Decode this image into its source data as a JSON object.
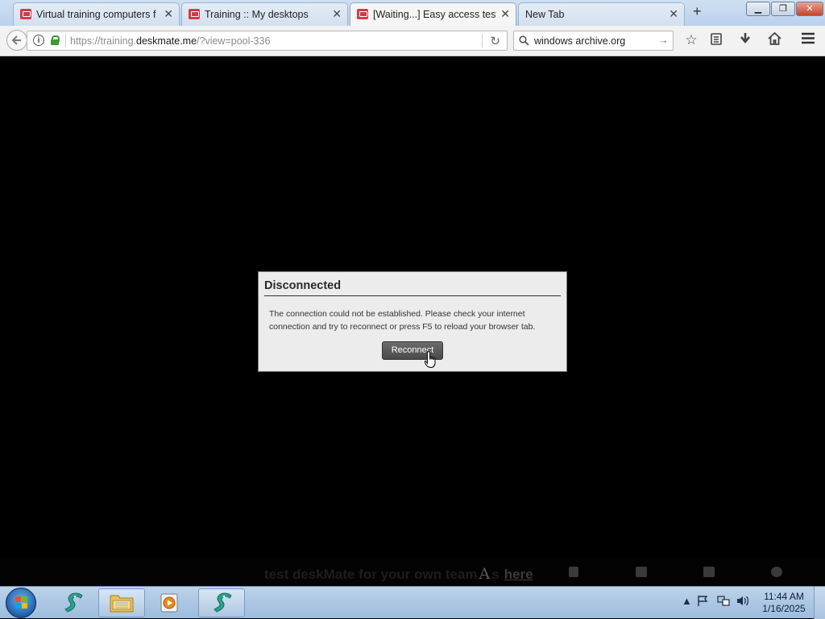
{
  "browser": {
    "tabs": [
      {
        "title": "Virtual training computers f",
        "favicon": "deskmate-icon",
        "active": false
      },
      {
        "title": "Training :: My desktops",
        "favicon": "deskmate-icon",
        "active": false
      },
      {
        "title": "[Waiting...] Easy access test",
        "favicon": "deskmate-icon",
        "active": true
      },
      {
        "title": "New Tab",
        "favicon": "none",
        "active": false
      }
    ],
    "tab_close_glyph": "✕",
    "new_tab_glyph": "+",
    "window_controls": {
      "minimize": "▁",
      "maximize": "❐",
      "close": "✕"
    },
    "url_prefix": "https://training.",
    "url_host": "deskmate.me",
    "url_suffix": "/?view=pool-336",
    "search_query": "windows archive.org"
  },
  "dialog": {
    "title": "Disconnected",
    "message": "The connection could not be established. Please check your internet connection and try to reconnect or press F5 to reload your browser tab.",
    "button_label": "Reconnect"
  },
  "bottom_bar": {
    "promo_text": "test deskMate for your own team",
    "promo_tail": "s",
    "link_label": "here"
  },
  "taskbar": {
    "time": "11:44 AM",
    "date": "1/16/2025"
  },
  "colors": {
    "accent_red": "#d23a4a",
    "secure_green": "#3c9a36"
  }
}
